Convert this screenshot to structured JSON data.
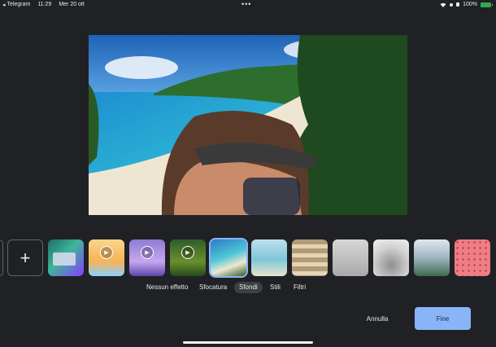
{
  "status_bar": {
    "back_app": "Telegram",
    "time": "11:29",
    "date": "Mer 20 ott",
    "battery": "100%",
    "more_dots": "•••"
  },
  "icons": {
    "back": "◂",
    "wifi": "wifi-icon",
    "add": "+"
  },
  "effects_carousel": {
    "add_label": "+",
    "thumbnails": [
      {
        "name": "partial-thumb",
        "selected": false
      },
      {
        "name": "add-background",
        "selected": false
      },
      {
        "name": "office-green-bg",
        "selected": false
      },
      {
        "name": "cartoon-animated-bg",
        "selected": false,
        "animated": true
      },
      {
        "name": "purple-room-animated-bg",
        "selected": false,
        "animated": true
      },
      {
        "name": "forest-animated-bg",
        "selected": false,
        "animated": true
      },
      {
        "name": "beach-bg",
        "selected": true
      },
      {
        "name": "sea-horizon-bg",
        "selected": false
      },
      {
        "name": "bookshelf-bg",
        "selected": false
      },
      {
        "name": "sketch-room-bg",
        "selected": false
      },
      {
        "name": "glass-dome-bg",
        "selected": false
      },
      {
        "name": "mountain-lake-bg",
        "selected": false
      },
      {
        "name": "pink-pattern-bg",
        "selected": false
      }
    ]
  },
  "tabs": [
    {
      "label": "Nessun effetto",
      "active": false
    },
    {
      "label": "Sfocatura",
      "active": false
    },
    {
      "label": "Sfondi",
      "active": true
    },
    {
      "label": "Stili",
      "active": false
    },
    {
      "label": "Filtri",
      "active": false
    }
  ],
  "actions": {
    "cancel_label": "Annulla",
    "done_label": "Fine"
  },
  "colors": {
    "background": "#202124",
    "accent": "#8ab4f8",
    "battery": "#34a853"
  }
}
